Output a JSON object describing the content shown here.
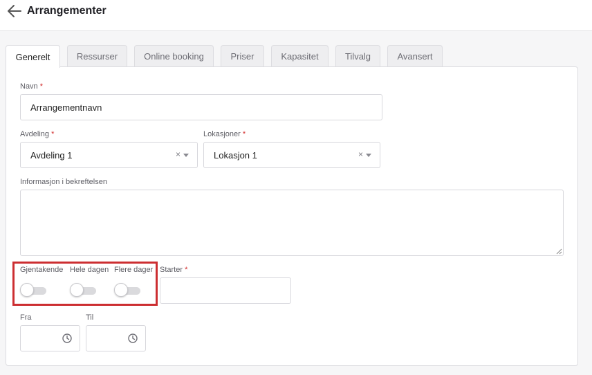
{
  "header": {
    "title": "Arrangementer",
    "back_icon": "arrow-left-icon"
  },
  "tabs": [
    {
      "label": "Generelt",
      "active": true
    },
    {
      "label": "Ressurser",
      "active": false
    },
    {
      "label": "Online booking",
      "active": false
    },
    {
      "label": "Priser",
      "active": false
    },
    {
      "label": "Kapasitet",
      "active": false
    },
    {
      "label": "Tilvalg",
      "active": false
    },
    {
      "label": "Avansert",
      "active": false
    }
  ],
  "form": {
    "required_mark": "*",
    "name": {
      "label": "Navn",
      "value": "Arrangementnavn"
    },
    "department": {
      "label": "Avdeling",
      "value": "Avdeling 1",
      "clear": "×"
    },
    "locations": {
      "label": "Lokasjoner",
      "value": "Lokasjon 1",
      "clear": "×"
    },
    "confirmation_info": {
      "label": "Informasjon i bekreftelsen",
      "value": ""
    },
    "toggles": {
      "recurring": {
        "label": "Gjentakende",
        "on": false
      },
      "all_day": {
        "label": "Hele dagen",
        "on": false
      },
      "multi_day": {
        "label": "Flere dager",
        "on": false
      }
    },
    "starts": {
      "label": "Starter",
      "value": ""
    },
    "from": {
      "label": "Fra",
      "value": ""
    },
    "to": {
      "label": "Til",
      "value": ""
    }
  },
  "colors": {
    "highlight": "#cc2e31",
    "required": "#d22b2b",
    "toggle_off": "#dadadd"
  }
}
